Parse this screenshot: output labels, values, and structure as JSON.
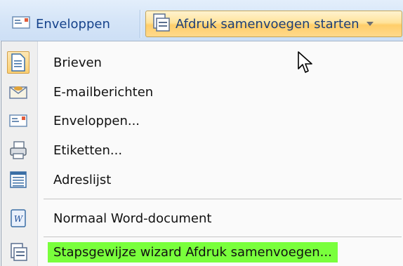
{
  "ribbon": {
    "envelopes_label": "Enveloppen",
    "start_merge_label": "Afdruk samenvoegen starten"
  },
  "menu": {
    "items": [
      {
        "id": "letters",
        "label": "Brieven",
        "icon": "letter-document-icon",
        "checked": true
      },
      {
        "id": "email",
        "label": "E-mailberichten",
        "icon": "email-envelope-icon"
      },
      {
        "id": "envelopes",
        "label": "Enveloppen...",
        "icon": "envelope-icon"
      },
      {
        "id": "labels",
        "label": "Etiketten...",
        "icon": "labels-icon"
      },
      {
        "id": "directory",
        "label": "Adreslijst",
        "icon": "directory-list-icon"
      },
      {
        "id": "normal",
        "label": "Normaal Word-document",
        "icon": "word-document-icon"
      },
      {
        "id": "wizard",
        "label": "Stapsgewijze wizard Afdruk samenvoegen...",
        "icon": "wizard-icon",
        "highlighted": true,
        "highlight_color": "#79ff3c"
      }
    ]
  },
  "colors": {
    "ribbon_text": "#15428b",
    "active_button": "#ffd98c",
    "highlight": "#79ff3c"
  }
}
